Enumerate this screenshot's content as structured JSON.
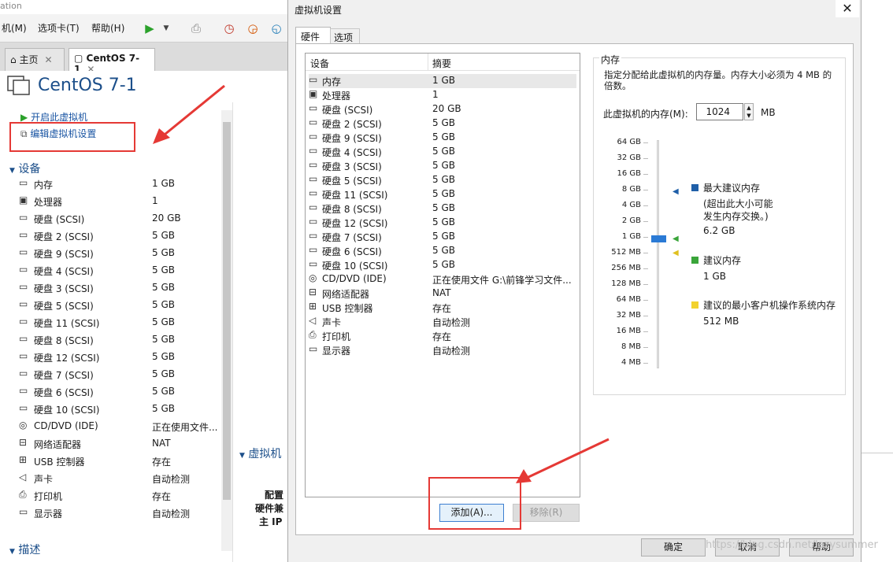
{
  "background_window": {
    "title_fragment": "ation",
    "menu": [
      "机(M)",
      "选项卡(T)",
      "帮助(H)"
    ],
    "tabs": [
      {
        "label": "主页"
      },
      {
        "label": "CentOS 7-1"
      }
    ],
    "vm_name": "CentOS 7-1",
    "actions": [
      "开启此虚拟机",
      "编辑虚拟机设置"
    ],
    "devices_section": "设备",
    "devices": [
      {
        "name": "内存",
        "value": "1 GB",
        "icon": "memory-icon"
      },
      {
        "name": "处理器",
        "value": "1",
        "icon": "cpu-icon"
      },
      {
        "name": "硬盘 (SCSI)",
        "value": "20 GB",
        "icon": "disk-icon"
      },
      {
        "name": "硬盘 2 (SCSI)",
        "value": "5 GB",
        "icon": "disk-icon"
      },
      {
        "name": "硬盘 9 (SCSI)",
        "value": "5 GB",
        "icon": "disk-icon"
      },
      {
        "name": "硬盘 4 (SCSI)",
        "value": "5 GB",
        "icon": "disk-icon"
      },
      {
        "name": "硬盘 3 (SCSI)",
        "value": "5 GB",
        "icon": "disk-icon"
      },
      {
        "name": "硬盘 5 (SCSI)",
        "value": "5 GB",
        "icon": "disk-icon"
      },
      {
        "name": "硬盘 11 (SCSI)",
        "value": "5 GB",
        "icon": "disk-icon"
      },
      {
        "name": "硬盘 8 (SCSI)",
        "value": "5 GB",
        "icon": "disk-icon"
      },
      {
        "name": "硬盘 12 (SCSI)",
        "value": "5 GB",
        "icon": "disk-icon"
      },
      {
        "name": "硬盘 7 (SCSI)",
        "value": "5 GB",
        "icon": "disk-icon"
      },
      {
        "name": "硬盘 6 (SCSI)",
        "value": "5 GB",
        "icon": "disk-icon"
      },
      {
        "name": "硬盘 10 (SCSI)",
        "value": "5 GB",
        "icon": "disk-icon"
      },
      {
        "name": "CD/DVD (IDE)",
        "value": "正在使用文件...",
        "icon": "cd-icon"
      },
      {
        "name": "网络适配器",
        "value": "NAT",
        "icon": "network-icon"
      },
      {
        "name": "USB 控制器",
        "value": "存在",
        "icon": "usb-icon"
      },
      {
        "name": "声卡",
        "value": "自动检测",
        "icon": "sound-icon"
      },
      {
        "name": "打印机",
        "value": "存在",
        "icon": "printer-icon"
      },
      {
        "name": "显示器",
        "value": "自动检测",
        "icon": "display-icon"
      }
    ],
    "description_section": "描述",
    "details_section": "虚拟机",
    "details_labels": [
      "配置",
      "硬件兼",
      "主 IP"
    ]
  },
  "dialog": {
    "title": "虚拟机设置",
    "tabs": [
      "硬件",
      "选项"
    ],
    "list_headers": {
      "device": "设备",
      "summary": "摘要"
    },
    "devices": [
      {
        "name": "内存",
        "value": "1 GB",
        "icon": "memory-icon"
      },
      {
        "name": "处理器",
        "value": "1",
        "icon": "cpu-icon"
      },
      {
        "name": "硬盘 (SCSI)",
        "value": "20 GB",
        "icon": "disk-icon"
      },
      {
        "name": "硬盘 2 (SCSI)",
        "value": "5 GB",
        "icon": "disk-icon"
      },
      {
        "name": "硬盘 9 (SCSI)",
        "value": "5 GB",
        "icon": "disk-icon"
      },
      {
        "name": "硬盘 4 (SCSI)",
        "value": "5 GB",
        "icon": "disk-icon"
      },
      {
        "name": "硬盘 3 (SCSI)",
        "value": "5 GB",
        "icon": "disk-icon"
      },
      {
        "name": "硬盘 5 (SCSI)",
        "value": "5 GB",
        "icon": "disk-icon"
      },
      {
        "name": "硬盘 11 (SCSI)",
        "value": "5 GB",
        "icon": "disk-icon"
      },
      {
        "name": "硬盘 8 (SCSI)",
        "value": "5 GB",
        "icon": "disk-icon"
      },
      {
        "name": "硬盘 12 (SCSI)",
        "value": "5 GB",
        "icon": "disk-icon"
      },
      {
        "name": "硬盘 7 (SCSI)",
        "value": "5 GB",
        "icon": "disk-icon"
      },
      {
        "name": "硬盘 6 (SCSI)",
        "value": "5 GB",
        "icon": "disk-icon"
      },
      {
        "name": "硬盘 10 (SCSI)",
        "value": "5 GB",
        "icon": "disk-icon"
      },
      {
        "name": "CD/DVD (IDE)",
        "value": "正在使用文件 G:\\前锋学习文件...",
        "icon": "cd-icon"
      },
      {
        "name": "网络适配器",
        "value": "NAT",
        "icon": "network-icon"
      },
      {
        "name": "USB 控制器",
        "value": "存在",
        "icon": "usb-icon"
      },
      {
        "name": "声卡",
        "value": "自动检测",
        "icon": "sound-icon"
      },
      {
        "name": "打印机",
        "value": "存在",
        "icon": "printer-icon"
      },
      {
        "name": "显示器",
        "value": "自动检测",
        "icon": "display-icon"
      }
    ],
    "add_button": "添加(A)...",
    "remove_button": "移除(R)",
    "memory": {
      "group_label": "内存",
      "description": "指定分配给此虚拟机的内存量。内存大小必须为 4 MB 的倍数。",
      "field_label": "此虚拟机的内存(M):",
      "value": "1024",
      "unit": "MB",
      "scale": [
        "64 GB",
        "32 GB",
        "16 GB",
        "8 GB",
        "4 GB",
        "2 GB",
        "1 GB",
        "512 MB",
        "256 MB",
        "128 MB",
        "64 MB",
        "32 MB",
        "16 MB",
        "8 MB",
        "4 MB"
      ],
      "legend": {
        "max_title": "最大建议内存",
        "max_note": "(超出此大小可能发生内存交换。)",
        "max_value": "6.2 GB",
        "rec_title": "建议内存",
        "rec_value": "1 GB",
        "min_title": "建议的最小客户机操作系统内存",
        "min_value": "512 MB"
      },
      "colors": {
        "max": "#1f5fa8",
        "rec": "#3aa53a",
        "min": "#f2d22e"
      }
    },
    "footer": {
      "ok": "确定",
      "cancel": "取消",
      "help": "帮助"
    },
    "watermark": "https://blog.csdn.net/lazysummer"
  }
}
